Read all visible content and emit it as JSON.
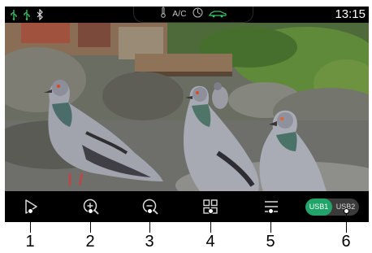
{
  "status_bar": {
    "icons_left": [
      "usb-icon",
      "usb-icon",
      "bluetooth-icon"
    ],
    "center": {
      "temperature_icon": "thermometer-icon",
      "ac_label": "A/C",
      "fan_icon": "fan-icon",
      "car_icon": "car-icon"
    },
    "clock": "13:15",
    "accent_color": "#38c46a"
  },
  "photo": {
    "subject": "pigeons"
  },
  "controls": {
    "buttons": [
      {
        "name": "play",
        "icon": "play-icon"
      },
      {
        "name": "zoom-in",
        "icon": "zoom-in-icon"
      },
      {
        "name": "zoom-out",
        "icon": "zoom-out-icon"
      },
      {
        "name": "grid-view",
        "icon": "grid-icon"
      },
      {
        "name": "list-menu",
        "icon": "menu-icon"
      }
    ],
    "usb_toggle": {
      "options": [
        "USB1",
        "USB2"
      ],
      "selected": "USB1",
      "active_color": "#21a46a"
    }
  },
  "callouts": [
    "1",
    "2",
    "3",
    "4",
    "5",
    "6"
  ]
}
